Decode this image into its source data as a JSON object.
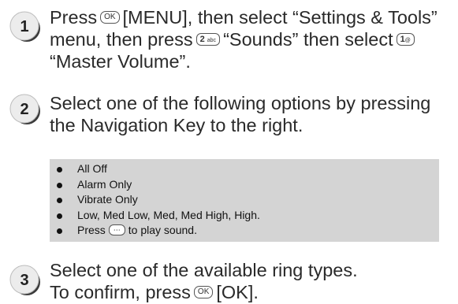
{
  "steps": [
    {
      "number": "1",
      "line1_a": "Press",
      "ok_key": "OK",
      "line1_b": "[MENU], then select “Settings & Tools”",
      "line2_a": "menu, then press",
      "key2_num": "2",
      "key2_sub": "abc",
      "line2_b": "“Sounds” then select",
      "key1_num": "1",
      "key1_sub": "@",
      "line3": "“Master Volume”."
    },
    {
      "number": "2",
      "line1": "Select one of the following options by pressing",
      "line2": "the Navigation Key to the right."
    },
    {
      "number": "3",
      "line1": "Select one of the available ring types.",
      "line2_a": "To confirm, press",
      "ok_key": "OK",
      "line2_b": "[OK]."
    }
  ],
  "options": [
    "All Off",
    "Alarm Only",
    "Vibrate Only",
    "Low, Med Low, Med, Med High, High."
  ],
  "last_option": {
    "before": "Press",
    "after": "to play sound."
  },
  "colors": {
    "badge_fill": "#e8e8e8",
    "badge_dark": "#3a3a3a",
    "options_bg": "#d4d4d4"
  }
}
